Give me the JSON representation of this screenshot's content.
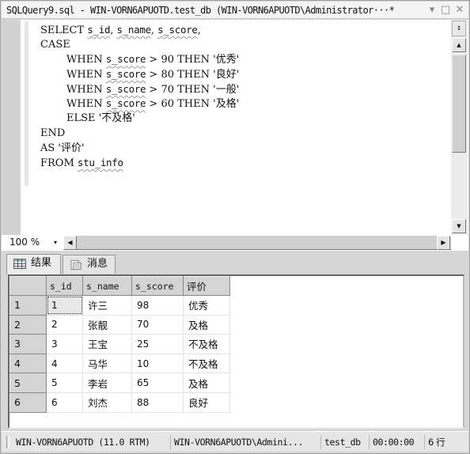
{
  "window": {
    "title": "SQLQuery9.sql - WIN-VORN6APUOTD.test_db (WIN-VORN6APUOTD\\Administrator···*",
    "controls": {
      "dropdown": "▾",
      "maximize": "□",
      "close": "✕"
    }
  },
  "editor": {
    "lines": [
      {
        "indent": "",
        "parts": [
          {
            "t": "SELECT "
          },
          {
            "t": "s_id",
            "sq": true
          },
          {
            "t": ", "
          },
          {
            "t": "s_name",
            "sq": true
          },
          {
            "t": ", "
          },
          {
            "t": "s_score",
            "sq": true
          },
          {
            "t": ","
          }
        ]
      },
      {
        "indent": "",
        "parts": [
          {
            "t": "CASE"
          }
        ]
      },
      {
        "indent": "    ",
        "parts": [
          {
            "t": "WHEN "
          },
          {
            "t": "s_score",
            "sq": true
          },
          {
            "t": " > 90 THEN '优秀'"
          }
        ]
      },
      {
        "indent": "    ",
        "parts": [
          {
            "t": "WHEN "
          },
          {
            "t": "s_score",
            "sq": true
          },
          {
            "t": " > 80 THEN '良好'"
          }
        ]
      },
      {
        "indent": "    ",
        "parts": [
          {
            "t": "WHEN "
          },
          {
            "t": "s_score",
            "sq": true
          },
          {
            "t": " > 70 THEN '一般'"
          }
        ]
      },
      {
        "indent": "    ",
        "parts": [
          {
            "t": "WHEN "
          },
          {
            "t": "s_score",
            "sq": true
          },
          {
            "t": " > 60 THEN '及格'"
          }
        ]
      },
      {
        "indent": "    ",
        "parts": [
          {
            "t": "ELSE '不及格'"
          }
        ]
      },
      {
        "indent": "",
        "parts": [
          {
            "t": "END"
          }
        ]
      },
      {
        "indent": "",
        "parts": [
          {
            "t": "AS '评价'"
          }
        ]
      },
      {
        "indent": "",
        "parts": [
          {
            "t": "FROM "
          },
          {
            "t": "stu_info",
            "sq": true
          }
        ]
      }
    ],
    "scrollbar": {
      "split_icon": "↕",
      "up_arrow": "▲",
      "down_arrow": "▼"
    }
  },
  "zoom": {
    "value": "100 %",
    "arrow": "▾",
    "hscroll_left": "◀",
    "hscroll_right": "▶"
  },
  "tabs": [
    {
      "label": "结果",
      "icon": "grid-icon",
      "active": true
    },
    {
      "label": "消息",
      "icon": "messages-icon",
      "active": false
    }
  ],
  "results": {
    "columns": [
      "s_id",
      "s_name",
      "s_score",
      "评价"
    ],
    "rows": [
      {
        "num": "1",
        "cells": [
          "1",
          "许三",
          "98",
          "优秀"
        ]
      },
      {
        "num": "2",
        "cells": [
          "2",
          "张靓",
          "70",
          "及格"
        ]
      },
      {
        "num": "3",
        "cells": [
          "3",
          "王宝",
          "25",
          "不及格"
        ]
      },
      {
        "num": "4",
        "cells": [
          "4",
          "马华",
          "10",
          "不及格"
        ]
      },
      {
        "num": "5",
        "cells": [
          "5",
          "李岩",
          "65",
          "及格"
        ]
      },
      {
        "num": "6",
        "cells": [
          "6",
          "刘杰",
          "88",
          "良好"
        ]
      }
    ]
  },
  "status": {
    "server": "WIN-VORN6APUOTD (11.0 RTM)",
    "user": "WIN-VORN6APUOTD\\Admini...",
    "database": "test_db",
    "elapsed": "00:00:00",
    "rows": "6 行"
  }
}
